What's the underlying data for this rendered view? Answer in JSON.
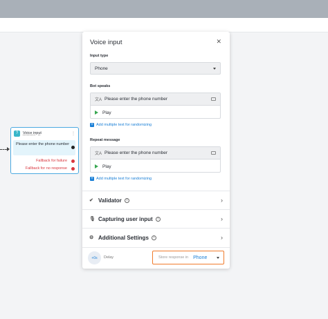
{
  "node": {
    "title": "Voice input",
    "body": "Please enter the phone number",
    "fallback_failure": "Fallback for failure",
    "fallback_no_response": "Fallback for no response"
  },
  "panel": {
    "title": "Voice input",
    "input_type_label": "Input type",
    "input_type_value": "Phone",
    "bot_speaks_label": "Bot speaks",
    "bot_speaks_text": "Please enter the phone number",
    "play_label": "Play",
    "add_text_label": "Add multiple text for randomizing",
    "repeat_label": "Repeat message",
    "repeat_text": "Please enter the phone number",
    "repeat_play_label": "Play",
    "repeat_add_text_label": "Add multiple text for randomizing",
    "sections": {
      "validator": "Validator",
      "capturing": "Capturing user input",
      "additional": "Additional Settings"
    },
    "footer": {
      "delay_badge": "+0s",
      "delay_label": "Delay",
      "store_label": "Store response in",
      "store_value": "Phone"
    }
  },
  "icons": [
    "close-icon",
    "chevron-down-icon",
    "translate-icon",
    "keyboard-icon",
    "play-icon",
    "plus-icon",
    "validator-icon",
    "mic-icon",
    "settings-icon",
    "info-icon",
    "chevron-right-icon"
  ],
  "colors": {
    "accent": "#1a7fd6",
    "highlight": "#f07a2a",
    "error": "#d9363e",
    "node_border": "#4aa8e0"
  }
}
